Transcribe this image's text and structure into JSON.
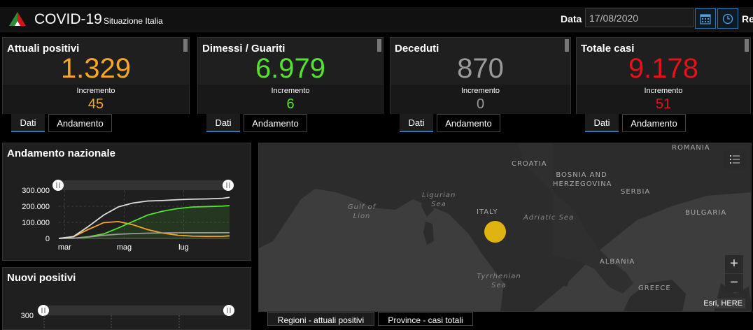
{
  "header": {
    "title": "COVID-19",
    "subtitle": "Situazione Italia",
    "date_label": "Data",
    "date_value": "17/08/2020",
    "truncated_label": "Re"
  },
  "cards": [
    {
      "title": "Attuali positivi",
      "value": "1.329",
      "inc_label": "Incremento",
      "inc_value": "45",
      "color": "#f5a623"
    },
    {
      "title": "Dimessi / Guariti",
      "value": "6.979",
      "inc_label": "Incremento",
      "inc_value": "6",
      "color": "#54e32c"
    },
    {
      "title": "Deceduti",
      "value": "870",
      "inc_label": "Incremento",
      "inc_value": "0",
      "color": "#9a9a9a"
    },
    {
      "title": "Totale casi",
      "value": "9.178",
      "inc_label": "Incremento",
      "inc_value": "51",
      "color": "#e5111b"
    }
  ],
  "card_tabs": {
    "dati": "Dati",
    "andamento": "Andamento"
  },
  "panels": {
    "andamento_title": "Andamento nazionale",
    "nuovi_title": "Nuovi positivi"
  },
  "chart_data": [
    {
      "type": "line",
      "title": "Andamento nazionale",
      "y_ticks": [
        "300.000",
        "200.000",
        "100.000",
        "0"
      ],
      "x_ticks": [
        "mar",
        "mag",
        "lug"
      ],
      "ylim": [
        0,
        300000
      ],
      "x": [
        "2020-02-24",
        "2020-03-10",
        "2020-03-25",
        "2020-04-10",
        "2020-04-25",
        "2020-05-10",
        "2020-05-25",
        "2020-06-10",
        "2020-06-25",
        "2020-07-10",
        "2020-07-25",
        "2020-08-10",
        "2020-08-17"
      ],
      "series": [
        {
          "values": [
            0,
            10000,
            55000,
            98000,
            105000,
            85000,
            55000,
            32000,
            20000,
            14000,
            12500,
            13000,
            16000
          ],
          "color": "#f5a623"
        },
        {
          "values": [
            0,
            1000,
            10000,
            28000,
            65000,
            105000,
            145000,
            170000,
            186000,
            195000,
            198000,
            201000,
            204000
          ],
          "color": "#54e32c"
        },
        {
          "values": [
            0,
            500,
            8000,
            19000,
            26000,
            30000,
            32500,
            34000,
            34700,
            35000,
            35100,
            35300,
            35400
          ],
          "color": "#9a9a9a"
        },
        {
          "values": [
            0,
            11500,
            73000,
            145000,
            196000,
            220000,
            232500,
            236000,
            240700,
            244000,
            245600,
            249300,
            255400
          ],
          "color": "#dddddd"
        }
      ],
      "grid": true
    },
    {
      "type": "bar",
      "title": "Nuovi positivi",
      "y_ticks": [
        "300"
      ],
      "values": []
    }
  ],
  "map": {
    "labels": {
      "romania": "ROMANIA",
      "croatia": "CROATIA",
      "bosnia": "BOSNIA AND HERZEGOVINA",
      "serbia": "SERBIA",
      "bulgaria": "BULGARIA",
      "italy": "ITALY",
      "albania": "ALBANIA",
      "greece": "GREECE",
      "ligurian": "Ligurian Sea",
      "gulf": "Gulf of Lion",
      "adriatic": "Adriatic Sea",
      "tyrrhenian": "Tyrrhenian Sea"
    },
    "zoom_in": "+",
    "zoom_out": "−",
    "attribution": "Esri, HERE",
    "marker_color": "#e0b410"
  },
  "bottom_tabs": {
    "regioni": "Regioni - attuali positivi",
    "province": "Province - casi totali"
  }
}
